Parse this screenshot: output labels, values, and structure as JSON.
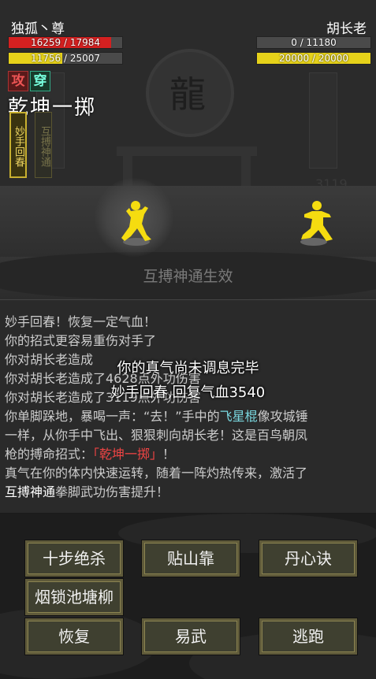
{
  "player": {
    "name": "独孤丶尊",
    "hp": "16259 / 17984",
    "hp_ratio": 0.904,
    "mp": "11756 / 25007",
    "mp_ratio": 0.47
  },
  "enemy": {
    "name": "胡长老",
    "hp": "0 / 11180",
    "hp_ratio": 0,
    "mp": "20000 / 20000",
    "mp_ratio": 1.0
  },
  "tags": {
    "attack": "攻",
    "wear": "穿"
  },
  "skill_title": "乾坤一掷",
  "skill_slots": [
    {
      "label": "妙手回春",
      "active": true
    },
    {
      "label": "互搏神通",
      "active": false
    }
  ],
  "background_number": "3119",
  "effect_text": "互搏神通生效",
  "log": {
    "lines": [
      "妙手回春！恢复一定气血！",
      "你的招式更容易重伤对手了",
      "你对胡长老造成",
      "你对胡长老造成了4628点外功伤害",
      "你对胡长老造成了3119点外功伤害",
      "枪的搏命招式：",
      "真气在你的体内快速运转，随着一阵灼热传来，激活了",
      "拳脚武功伤害提升！"
    ],
    "line8_a": "你单脚跺地，暴喝一声：“去！”手中的",
    "line8_b": "飞星棍",
    "line8_c": "像攻城锤",
    "line9": "一样，从你手中飞出、狠狠刺向胡长老！这是百鸟朝凤",
    "line10_b": "「乾坤一掷」",
    "line10_c": "！",
    "line12_a": "互搏神通"
  },
  "overlay": {
    "line1": "你的真气尚未调息完毕",
    "line2": "妙手回春,回复气血3540"
  },
  "buttons": {
    "shibu": "十步绝杀",
    "tieshan": "贴山靠",
    "danxin": "丹心诀",
    "yansuo": "烟锁池塘柳",
    "recover": "恢复",
    "yiwu": "易武",
    "flee": "逃跑"
  },
  "colors": {
    "hp": "#d42020",
    "mp": "#e6d21a",
    "fighter": "#f5dc10",
    "skill_highlight": "#7ad8e0",
    "move_name": "#e44444"
  }
}
